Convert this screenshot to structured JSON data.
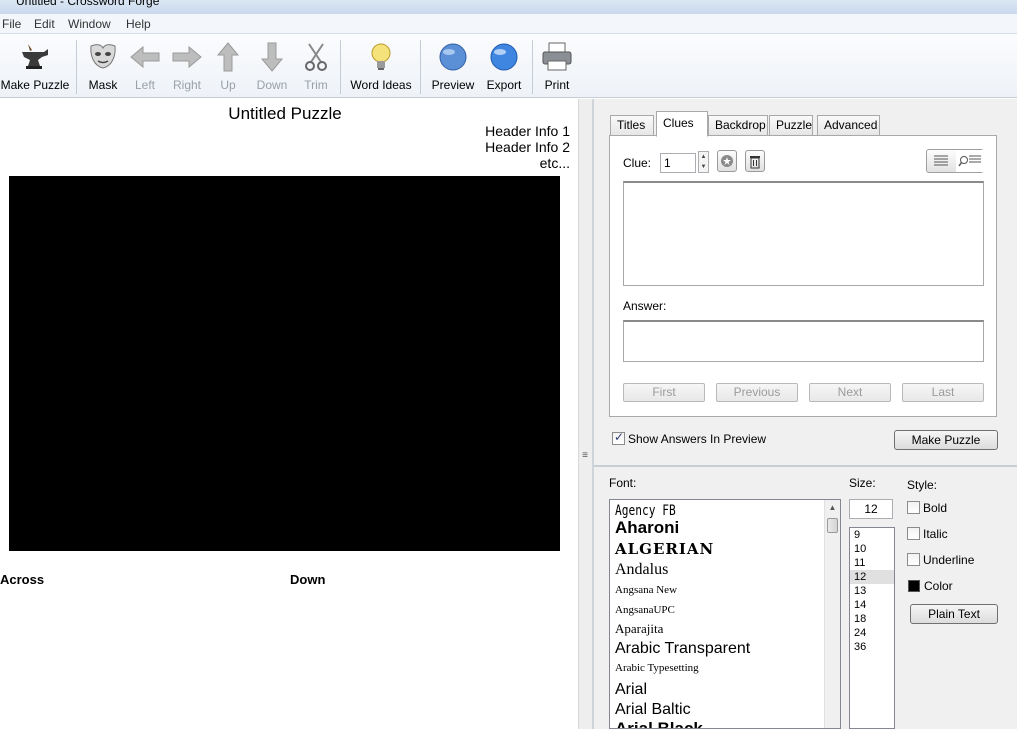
{
  "window": {
    "title": "Untitled - Crossword Forge"
  },
  "menu": [
    "File",
    "Edit",
    "Window",
    "Help"
  ],
  "toolbar": {
    "make_puzzle": "Make Puzzle",
    "mask": "Mask",
    "left": "Left",
    "right": "Right",
    "up": "Up",
    "down": "Down",
    "trim": "Trim",
    "word_ideas": "Word Ideas",
    "preview": "Preview",
    "export": "Export",
    "print": "Print"
  },
  "preview": {
    "title": "Untitled Puzzle",
    "header_info_1": "Header Info 1",
    "header_info_2": "Header Info 2",
    "header_etc": "etc...",
    "across": "Across",
    "down": "Down"
  },
  "tabs": [
    "Titles",
    "Clues",
    "Backdrop",
    "Puzzle",
    "Advanced"
  ],
  "clues": {
    "clue_label": "Clue:",
    "clue_value": "1",
    "answer_label": "Answer:",
    "first": "First",
    "previous": "Previous",
    "next": "Next",
    "last": "Last"
  },
  "options": {
    "show_answers": "Show Answers In Preview",
    "show_answers_checked": true,
    "make_puzzle": "Make Puzzle"
  },
  "font": {
    "font_label": "Font:",
    "size_label": "Size:",
    "style_label": "Style:",
    "size_value": "12",
    "fonts": [
      "Agency FB",
      "Aharoni",
      "ALGERIAN",
      "Andalus",
      "Angsana New",
      "AngsanaUPC",
      "Aparajita",
      "Arabic Transparent",
      "Arabic Typesetting",
      "Arial",
      "Arial Baltic",
      "Arial Black"
    ],
    "sizes": [
      "9",
      "10",
      "11",
      "12",
      "13",
      "14",
      "18",
      "24",
      "36"
    ],
    "selected_size": "12",
    "bold": "Bold",
    "italic": "Italic",
    "underline": "Underline",
    "color": "Color",
    "plain_text": "Plain Text"
  }
}
